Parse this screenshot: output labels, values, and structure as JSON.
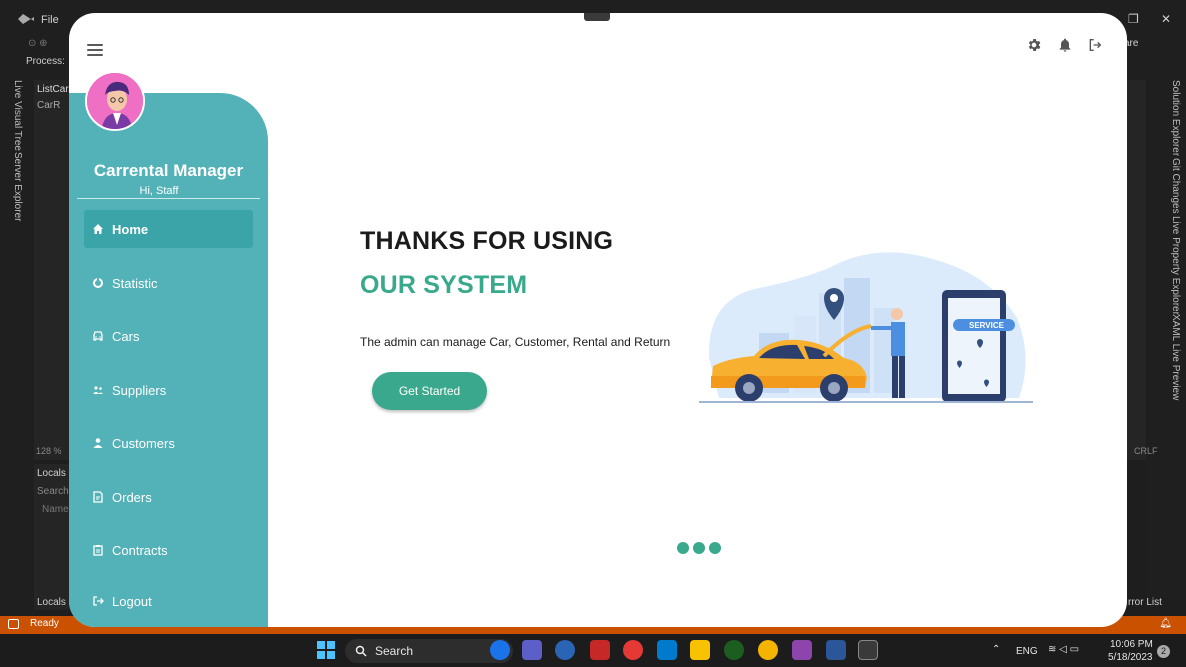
{
  "vs": {
    "menu_file": "File",
    "process_label": "Process:",
    "left_tabs": [
      "Live Visual Tree",
      "Server Explorer"
    ],
    "right_tabs": [
      "Solution Explorer",
      "Git Changes",
      "Live Property Explorer",
      "XAML Live Preview"
    ],
    "list_file": "ListCar",
    "list_sub": "CarR",
    "zoom": "128 %",
    "line_ending": "CRLF",
    "locals_title": "Locals",
    "locals_search": "Search",
    "locals_col": "Name",
    "locals_tab": "Locals",
    "error_list": "rror List",
    "share": "are",
    "status_ready": "Ready"
  },
  "app": {
    "brand": "Carrental Manager",
    "greeting": "Hi, Staff",
    "nav": [
      {
        "label": "Home",
        "icon": "home-icon"
      },
      {
        "label": "Statistic",
        "icon": "statistic-icon"
      },
      {
        "label": "Cars",
        "icon": "car-icon"
      },
      {
        "label": "Suppliers",
        "icon": "suppliers-icon"
      },
      {
        "label": "Customers",
        "icon": "customer-icon"
      },
      {
        "label": "Orders",
        "icon": "orders-icon"
      },
      {
        "label": "Contracts",
        "icon": "contracts-icon"
      },
      {
        "label": "Logout",
        "icon": "logout-icon"
      }
    ],
    "active_nav": "Home",
    "hero": {
      "line1": "THANKS FOR USING",
      "line2": "OUR SYSTEM",
      "description": "The admin can manage Car, Customer, Rental and Return",
      "cta": "Get Started"
    },
    "illustration_badge": "SERVICE",
    "top_icons": [
      "settings-icon",
      "notification-icon",
      "logout-icon"
    ],
    "colors": {
      "sidebar": "#53b2b7",
      "accent": "#3aa88c"
    }
  },
  "taskbar": {
    "search": "Search",
    "language": "ENG",
    "time": "10:06 PM",
    "date": "5/18/2023",
    "notification_count": "2"
  }
}
